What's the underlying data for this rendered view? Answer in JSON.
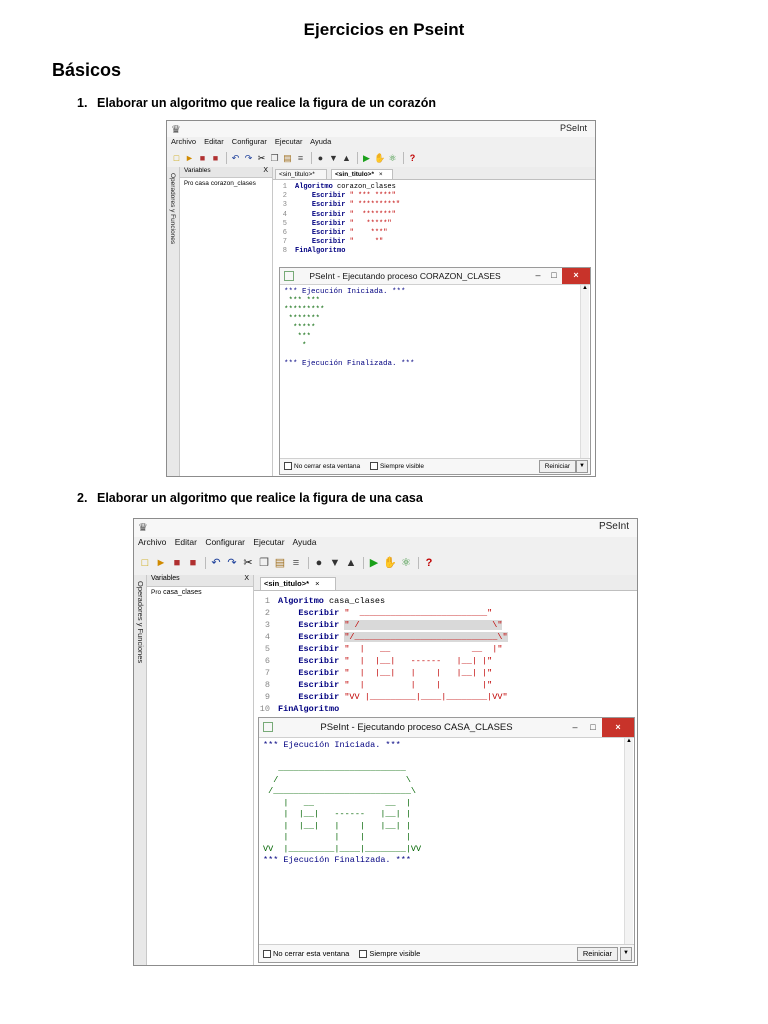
{
  "doc": {
    "title": "Ejercicios en Pseint",
    "section": "Básicos",
    "ex1": {
      "num": "1.",
      "text": "Elaborar un algoritmo que realice la figura de un corazón"
    },
    "ex2": {
      "num": "2.",
      "text": "Elaborar un algoritmo que realice la figura de una casa"
    }
  },
  "app": {
    "title": "PSeInt",
    "menu": [
      "Archivo",
      "Editar",
      "Configurar",
      "Ejecutar",
      "Ayuda"
    ],
    "side_tab": "Operadores y Funciones",
    "var_panel_title": "Variables",
    "close_x": "X",
    "tab_close": "×",
    "reiniciar": "Reiniciar",
    "no_cerrar": "No cerrar esta ventana",
    "siempre_visible": "Siempre visible"
  },
  "win1": {
    "var_item": "casa corazon_clases",
    "tab_inactive": "<sin_titulo>*",
    "tab_active": "<sin_titulo>*",
    "code": [
      {
        "n": "1",
        "kw": "Algoritmo",
        "rest": " corazon_clases",
        "s": ""
      },
      {
        "n": "2",
        "kw": "Escribir",
        "rest": " ",
        "s": "\" *** ****\""
      },
      {
        "n": "3",
        "kw": "Escribir",
        "rest": " ",
        "s": "\" *********\""
      },
      {
        "n": "4",
        "kw": "Escribir",
        "rest": " ",
        "s": "\"  *******\""
      },
      {
        "n": "5",
        "kw": "Escribir",
        "rest": " ",
        "s": "\"   *****\""
      },
      {
        "n": "6",
        "kw": "Escribir",
        "rest": " ",
        "s": "\"    ***\""
      },
      {
        "n": "7",
        "kw": "Escribir",
        "rest": " ",
        "s": "\"     *\""
      },
      {
        "n": "8",
        "kw": "FinAlgoritmo",
        "rest": "",
        "s": ""
      }
    ],
    "exec_title": "PSeInt - Ejecutando proceso CORAZON_CLASES",
    "console_start": "*** Ejecución Iniciada. ***",
    "output": [
      " *** ***",
      "*********",
      " *******",
      "  *****",
      "   ***",
      "    *"
    ],
    "console_end": "*** Ejecución Finalizada. ***"
  },
  "win2": {
    "var_item": "casa_clases",
    "tab_active": "<sin_titulo>*",
    "code": [
      {
        "n": "1",
        "kw": "Algoritmo",
        "rest": " casa_clases",
        "s": "",
        "hl": false
      },
      {
        "n": "2",
        "kw": "Escribir",
        "rest": " ",
        "s": "\"  _________________________\"",
        "hl": false
      },
      {
        "n": "3",
        "kw": "Escribir",
        "rest": " ",
        "s": "\" /                          \\\"",
        "hl": true
      },
      {
        "n": "4",
        "kw": "Escribir",
        "rest": " ",
        "s": "\"/____________________________\\\"",
        "hl": true
      },
      {
        "n": "5",
        "kw": "Escribir",
        "rest": " ",
        "s": "\"  |   __                __  |\"",
        "hl": false
      },
      {
        "n": "6",
        "kw": "Escribir",
        "rest": " ",
        "s": "\"  |  |__|   ------   |__| |\"",
        "hl": false
      },
      {
        "n": "7",
        "kw": "Escribir",
        "rest": " ",
        "s": "\"  |  |__|   |    |   |__| |\"",
        "hl": false
      },
      {
        "n": "8",
        "kw": "Escribir",
        "rest": " ",
        "s": "\"  |         |    |        |\"",
        "hl": false
      },
      {
        "n": "9",
        "kw": "Escribir",
        "rest": " ",
        "s": "\"VV |_________|____|________|VV\"",
        "hl": false
      },
      {
        "n": "10",
        "kw": "FinAlgoritmo",
        "rest": "",
        "s": "",
        "hl": false
      }
    ],
    "exec_title": "PSeInt - Ejecutando proceso CASA_CLASES",
    "console_start": "*** Ejecución Iniciada. ***",
    "output": [
      "   _________________________",
      "  /                         \\",
      " /___________________________\\",
      "    |   __              __  |",
      "    |  |__|   ------   |__| |",
      "    |  |__|   |    |   |__| |",
      "    |         |    |        |",
      "VV  |_________|____|________|VV"
    ],
    "console_end": "*** Ejecución Finalizada. ***"
  }
}
